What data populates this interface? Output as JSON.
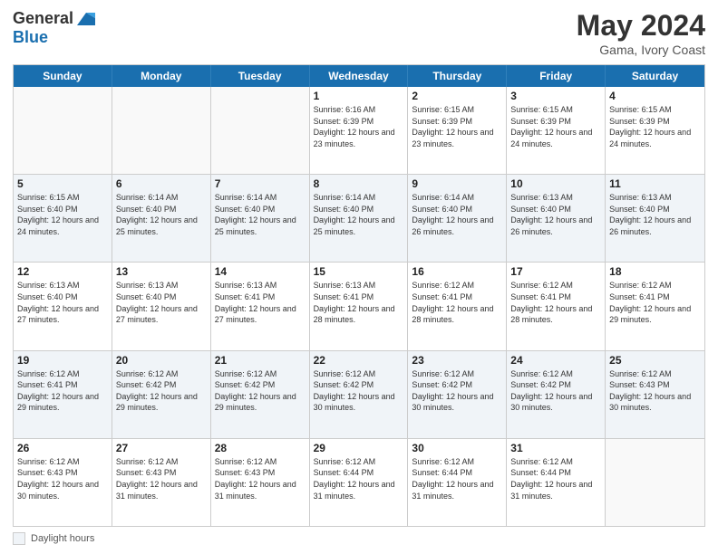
{
  "header": {
    "logo_general": "General",
    "logo_blue": "Blue",
    "title": "May 2024",
    "subtitle": "Gama, Ivory Coast"
  },
  "days_of_week": [
    "Sunday",
    "Monday",
    "Tuesday",
    "Wednesday",
    "Thursday",
    "Friday",
    "Saturday"
  ],
  "weeks": [
    [
      {
        "day": "",
        "info": ""
      },
      {
        "day": "",
        "info": ""
      },
      {
        "day": "",
        "info": ""
      },
      {
        "day": "1",
        "info": "Sunrise: 6:16 AM\nSunset: 6:39 PM\nDaylight: 12 hours and 23 minutes."
      },
      {
        "day": "2",
        "info": "Sunrise: 6:15 AM\nSunset: 6:39 PM\nDaylight: 12 hours and 23 minutes."
      },
      {
        "day": "3",
        "info": "Sunrise: 6:15 AM\nSunset: 6:39 PM\nDaylight: 12 hours and 24 minutes."
      },
      {
        "day": "4",
        "info": "Sunrise: 6:15 AM\nSunset: 6:39 PM\nDaylight: 12 hours and 24 minutes."
      }
    ],
    [
      {
        "day": "5",
        "info": "Sunrise: 6:15 AM\nSunset: 6:40 PM\nDaylight: 12 hours and 24 minutes."
      },
      {
        "day": "6",
        "info": "Sunrise: 6:14 AM\nSunset: 6:40 PM\nDaylight: 12 hours and 25 minutes."
      },
      {
        "day": "7",
        "info": "Sunrise: 6:14 AM\nSunset: 6:40 PM\nDaylight: 12 hours and 25 minutes."
      },
      {
        "day": "8",
        "info": "Sunrise: 6:14 AM\nSunset: 6:40 PM\nDaylight: 12 hours and 25 minutes."
      },
      {
        "day": "9",
        "info": "Sunrise: 6:14 AM\nSunset: 6:40 PM\nDaylight: 12 hours and 26 minutes."
      },
      {
        "day": "10",
        "info": "Sunrise: 6:13 AM\nSunset: 6:40 PM\nDaylight: 12 hours and 26 minutes."
      },
      {
        "day": "11",
        "info": "Sunrise: 6:13 AM\nSunset: 6:40 PM\nDaylight: 12 hours and 26 minutes."
      }
    ],
    [
      {
        "day": "12",
        "info": "Sunrise: 6:13 AM\nSunset: 6:40 PM\nDaylight: 12 hours and 27 minutes."
      },
      {
        "day": "13",
        "info": "Sunrise: 6:13 AM\nSunset: 6:40 PM\nDaylight: 12 hours and 27 minutes."
      },
      {
        "day": "14",
        "info": "Sunrise: 6:13 AM\nSunset: 6:41 PM\nDaylight: 12 hours and 27 minutes."
      },
      {
        "day": "15",
        "info": "Sunrise: 6:13 AM\nSunset: 6:41 PM\nDaylight: 12 hours and 28 minutes."
      },
      {
        "day": "16",
        "info": "Sunrise: 6:12 AM\nSunset: 6:41 PM\nDaylight: 12 hours and 28 minutes."
      },
      {
        "day": "17",
        "info": "Sunrise: 6:12 AM\nSunset: 6:41 PM\nDaylight: 12 hours and 28 minutes."
      },
      {
        "day": "18",
        "info": "Sunrise: 6:12 AM\nSunset: 6:41 PM\nDaylight: 12 hours and 29 minutes."
      }
    ],
    [
      {
        "day": "19",
        "info": "Sunrise: 6:12 AM\nSunset: 6:41 PM\nDaylight: 12 hours and 29 minutes."
      },
      {
        "day": "20",
        "info": "Sunrise: 6:12 AM\nSunset: 6:42 PM\nDaylight: 12 hours and 29 minutes."
      },
      {
        "day": "21",
        "info": "Sunrise: 6:12 AM\nSunset: 6:42 PM\nDaylight: 12 hours and 29 minutes."
      },
      {
        "day": "22",
        "info": "Sunrise: 6:12 AM\nSunset: 6:42 PM\nDaylight: 12 hours and 30 minutes."
      },
      {
        "day": "23",
        "info": "Sunrise: 6:12 AM\nSunset: 6:42 PM\nDaylight: 12 hours and 30 minutes."
      },
      {
        "day": "24",
        "info": "Sunrise: 6:12 AM\nSunset: 6:42 PM\nDaylight: 12 hours and 30 minutes."
      },
      {
        "day": "25",
        "info": "Sunrise: 6:12 AM\nSunset: 6:43 PM\nDaylight: 12 hours and 30 minutes."
      }
    ],
    [
      {
        "day": "26",
        "info": "Sunrise: 6:12 AM\nSunset: 6:43 PM\nDaylight: 12 hours and 30 minutes."
      },
      {
        "day": "27",
        "info": "Sunrise: 6:12 AM\nSunset: 6:43 PM\nDaylight: 12 hours and 31 minutes."
      },
      {
        "day": "28",
        "info": "Sunrise: 6:12 AM\nSunset: 6:43 PM\nDaylight: 12 hours and 31 minutes."
      },
      {
        "day": "29",
        "info": "Sunrise: 6:12 AM\nSunset: 6:44 PM\nDaylight: 12 hours and 31 minutes."
      },
      {
        "day": "30",
        "info": "Sunrise: 6:12 AM\nSunset: 6:44 PM\nDaylight: 12 hours and 31 minutes."
      },
      {
        "day": "31",
        "info": "Sunrise: 6:12 AM\nSunset: 6:44 PM\nDaylight: 12 hours and 31 minutes."
      },
      {
        "day": "",
        "info": ""
      }
    ]
  ],
  "footer": {
    "label": "Daylight hours"
  }
}
